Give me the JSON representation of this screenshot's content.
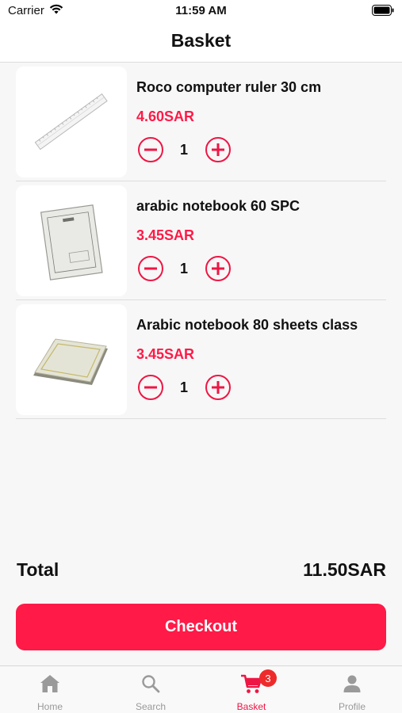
{
  "status_bar": {
    "carrier": "Carrier",
    "time": "11:59 AM"
  },
  "header": {
    "title": "Basket"
  },
  "basket": {
    "items": [
      {
        "name": "Roco computer ruler 30 cm",
        "price": "4.60SAR",
        "quantity": "1",
        "image_icon": "ruler-image"
      },
      {
        "name": "arabic notebook 60 SPC",
        "price": "3.45SAR",
        "quantity": "1",
        "image_icon": "notebook-image"
      },
      {
        "name": "Arabic notebook 80 sheets class",
        "price": "3.45SAR",
        "quantity": "1",
        "image_icon": "notebook-image"
      }
    ],
    "minus_icon": "minus-circle-icon",
    "plus_icon": "plus-circle-icon"
  },
  "summary": {
    "total_label": "Total",
    "total_value": "11.50SAR"
  },
  "checkout": {
    "label": "Checkout"
  },
  "tab_bar": {
    "tabs": [
      {
        "label": "Home",
        "icon": "home-icon"
      },
      {
        "label": "Search",
        "icon": "search-icon"
      },
      {
        "label": "Basket",
        "icon": "cart-icon",
        "active": true,
        "badge": "3"
      },
      {
        "label": "Profile",
        "icon": "person-icon"
      }
    ]
  },
  "colors": {
    "accent": "#ff1a47",
    "background": "#f7f7f7",
    "badge": "#ee2b2b",
    "inactive_tab": "#999999"
  }
}
